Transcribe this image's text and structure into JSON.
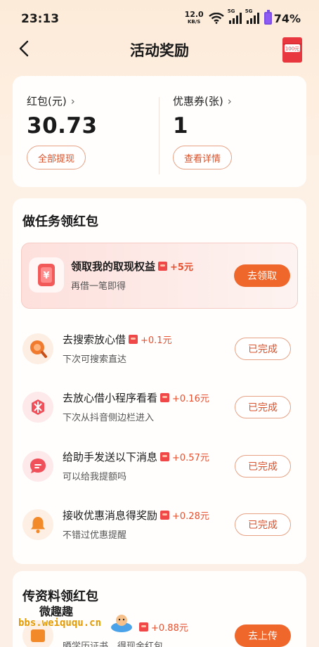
{
  "status_bar": {
    "time": "23:13",
    "net_speed_value": "12.0",
    "net_speed_unit": "KB/S",
    "sim1_tag": "5G",
    "sim2_tag": "5G",
    "battery": "74%"
  },
  "nav": {
    "title": "活动奖励",
    "redpack_label": "100元"
  },
  "balance": {
    "hongbao": {
      "label": "红包(元)",
      "value": "30.73",
      "button": "全部提现"
    },
    "coupon": {
      "label": "优惠券(张)",
      "value": "1",
      "button": "查看详情"
    }
  },
  "tasks": {
    "title": "做任务领红包",
    "featured": {
      "title": "领取我的取现权益",
      "reward": "+5元",
      "subtitle": "再借一笔即得",
      "button": "去领取"
    },
    "items": [
      {
        "title": "去搜索放心借",
        "reward": "+0.1元",
        "subtitle": "下次可搜索直达",
        "button": "已完成",
        "icon": "search-icon",
        "color": "#f07b2f"
      },
      {
        "title": "去放心借小程序看看",
        "reward": "+0.16元",
        "subtitle": "下次从抖音侧边栏进入",
        "button": "已完成",
        "icon": "mini-program-icon",
        "color": "#f0505a"
      },
      {
        "title": "给助手发送以下消息",
        "reward": "+0.57元",
        "subtitle": "可以给我提额吗",
        "button": "已完成",
        "icon": "chat-icon",
        "color": "#f0505a"
      },
      {
        "title": "接收优惠消息得奖励",
        "reward": "+0.28元",
        "subtitle": "不错过优惠提醒",
        "button": "已完成",
        "icon": "bell-icon",
        "color": "#f28a2a"
      }
    ]
  },
  "upload": {
    "title": "传资料领红包",
    "item": {
      "title": "",
      "reward": "+0.88元",
      "subtitle": "晒学历证书，得现金红包",
      "button": "去上传"
    }
  },
  "watermark": {
    "top": "微趣趣",
    "bottom": "bbs.weiququ.cn"
  }
}
